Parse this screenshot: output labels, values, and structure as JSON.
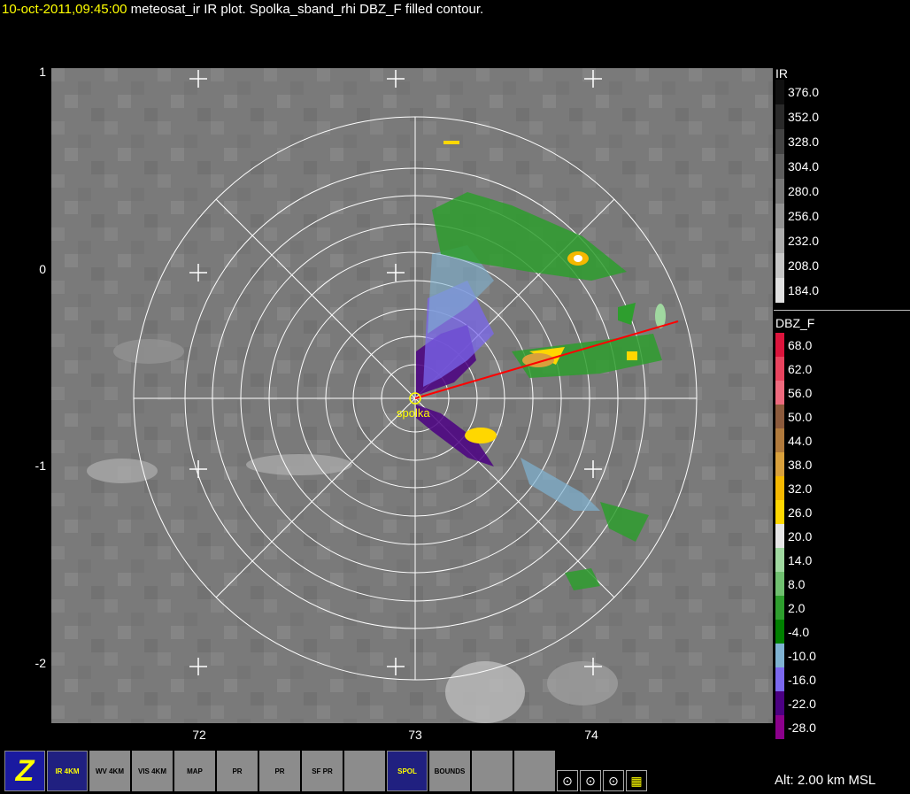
{
  "header": {
    "timestamp": "10-oct-2011,09:45:00",
    "description": " meteosat_ir IR  plot.  Spolka_sband_rhi DBZ_F filled contour."
  },
  "axes": {
    "y_labels": [
      "1",
      "0",
      "-1",
      "-2"
    ],
    "x_labels": [
      "72",
      "73",
      "74"
    ]
  },
  "radar": {
    "site_label": "spolka"
  },
  "colorbars": {
    "ir": {
      "title": "IR",
      "labels": [
        "376.0",
        "352.0",
        "328.0",
        "304.0",
        "280.0",
        "256.0",
        "232.0",
        "208.0",
        "184.0"
      ],
      "colors": [
        "#101010",
        "#2a2a2a",
        "#444444",
        "#5e5e5e",
        "#787878",
        "#929292",
        "#acacac",
        "#c6c6c6",
        "#e0e0e0"
      ]
    },
    "dbz": {
      "title": "DBZ_F",
      "labels": [
        "68.0",
        "62.0",
        "56.0",
        "50.0",
        "44.0",
        "38.0",
        "32.0",
        "26.0",
        "20.0",
        "14.0",
        "8.0",
        "2.0",
        "-4.0",
        "-10.0",
        "-16.0",
        "-22.0",
        "-28.0"
      ],
      "colors": [
        "#dc143c",
        "#e8435e",
        "#ee6a7e",
        "#8b5a3c",
        "#b07a3c",
        "#d8a03c",
        "#f5b800",
        "#ffd700",
        "#e6e6e6",
        "#a0d8a0",
        "#70c070",
        "#2e9e2e",
        "#008000",
        "#7fb2d2",
        "#7b68ee",
        "#4b0082",
        "#8b008b"
      ]
    }
  },
  "toolbar": {
    "buttons": [
      {
        "name": "zoom-button",
        "label": "Z"
      },
      {
        "name": "ir-4km-button",
        "label": "IR 4KM"
      },
      {
        "name": "wv-4km-button",
        "label": "WV 4KM"
      },
      {
        "name": "vis-4km-button",
        "label": "VIS 4KM"
      },
      {
        "name": "map-button",
        "label": "MAP"
      },
      {
        "name": "radar-pr-button-1",
        "label": "PR"
      },
      {
        "name": "radar-pr-button-2",
        "label": "PR"
      },
      {
        "name": "sf-pr-button",
        "label": "SF PR"
      },
      {
        "name": "search-magnifier-button",
        "label": ""
      },
      {
        "name": "spol-button",
        "label": "SPOL"
      },
      {
        "name": "bounds-button",
        "label": "BOUNDS"
      },
      {
        "name": "rings-button-1",
        "label": ""
      },
      {
        "name": "rings-button-2",
        "label": ""
      }
    ],
    "small_buttons": [
      {
        "name": "target-button-1"
      },
      {
        "name": "target-button-2"
      },
      {
        "name": "target-button-3"
      },
      {
        "name": "grid-button"
      }
    ]
  },
  "altitude": {
    "label": "Alt: 2.00 km MSL"
  }
}
